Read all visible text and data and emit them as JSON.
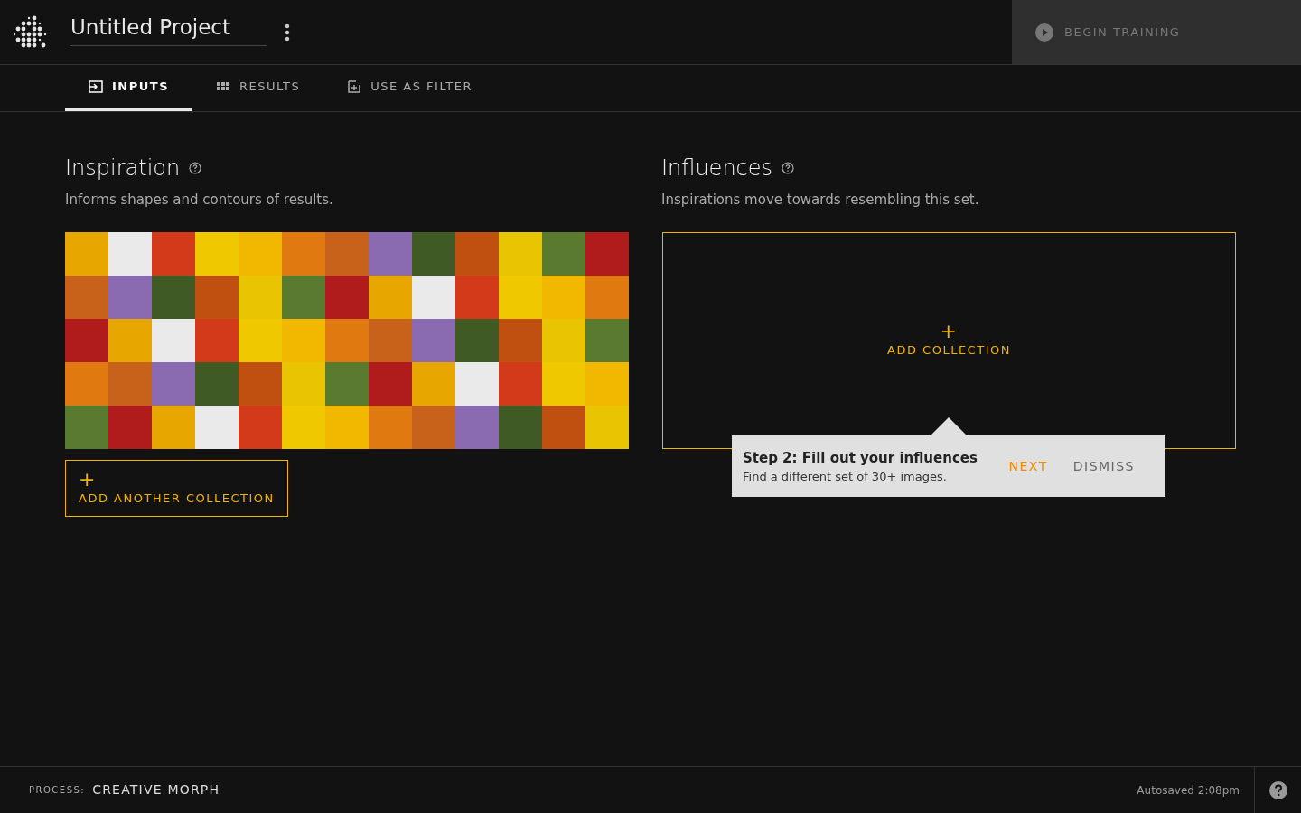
{
  "header": {
    "project_title": "Untitled Project",
    "begin_training": {
      "label": "BEGIN TRAINING",
      "disabled": true
    }
  },
  "tabs": [
    {
      "label": "INPUTS",
      "kind": "input",
      "selected": true
    },
    {
      "label": "RESULTS",
      "kind": "grid",
      "selected": false
    },
    {
      "label": "USE AS FILTER",
      "kind": "filter",
      "selected": false
    }
  ],
  "inspiration": {
    "title": "Inspiration",
    "subtitle": "Informs shapes and contours of results.",
    "add_button": {
      "icon": "+",
      "label": "ADD ANOTHER COLLECTION"
    }
  },
  "influences": {
    "title": "Influences",
    "subtitle": "Inspirations move towards resembling this set.",
    "add_button": {
      "icon": "+",
      "label": "ADD COLLECTION"
    }
  },
  "tooltip": {
    "title": "Step 2: Fill out your influences",
    "text": "Find a different set of 30+ images.",
    "buttons": [
      {
        "label": "NEXT",
        "kind": "primary"
      },
      {
        "label": "DISMISS",
        "kind": "secondary"
      }
    ]
  },
  "status_bar": {
    "process_label": "PROCESS:",
    "process_value": "CREATIVE MORPH",
    "autosave": "Autosaved 2:08pm"
  }
}
